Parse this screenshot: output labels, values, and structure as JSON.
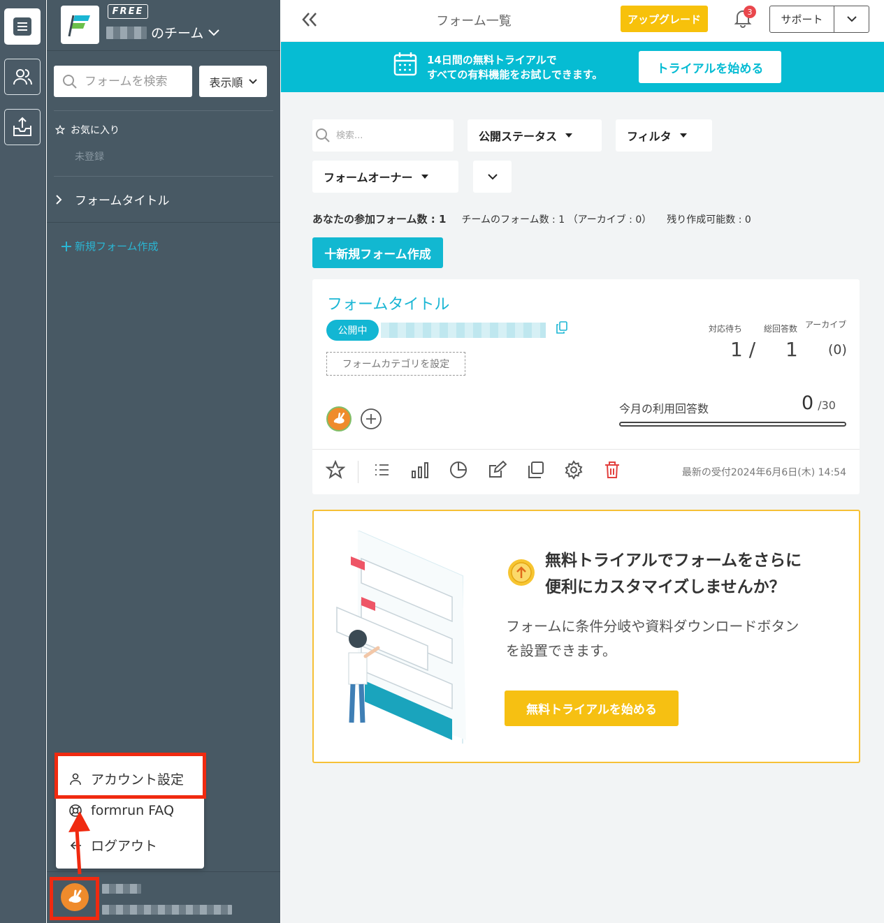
{
  "team": {
    "plan_badge": "FREE",
    "name_suffix": "のチーム"
  },
  "sidebar": {
    "search_placeholder": "フォームを検索",
    "sort_label": "表示順",
    "favorites_label": "お気に入り",
    "favorites_empty": "未登録",
    "form_item": "フォームタイトル",
    "new_form": "新規フォーム作成"
  },
  "account_menu": {
    "items": [
      {
        "label": "アカウント設定",
        "icon": "user-icon"
      },
      {
        "label": "formrun FAQ",
        "icon": "lifebuoy-icon"
      },
      {
        "label": "ログアウト",
        "icon": "logout-arrow-icon"
      }
    ]
  },
  "topbar": {
    "title": "フォーム一覧",
    "upgrade": "アップグレード",
    "notifications_count": "3",
    "support": "サポート"
  },
  "banner": {
    "line1": "14日間の無料トライアルで",
    "line2": "すべての有料機能をお試しできます。",
    "button": "トライアルを始める"
  },
  "filters": {
    "search_placeholder": "検索...",
    "status": "公開ステータス",
    "filter": "フィルタ",
    "owner": "フォームオーナー"
  },
  "counts": {
    "participating": "あなたの参加フォーム数 : 1",
    "team": "チームのフォーム数 : 1 （アーカイブ : 0）",
    "remaining": "残り作成可能数 : 0"
  },
  "new_form_button": "十新規フォーム作成",
  "form_card": {
    "title": "フォームタイトル",
    "status": "公開中",
    "category_button": "フォームカテゴリを設定",
    "stats": {
      "pending_label": "対応待ち",
      "pending_value": "1 /",
      "total_label": "総回答数",
      "total_value": "1",
      "archive_label": "アーカイブ",
      "archive_value": "(0)"
    },
    "usage_label": "今月の利用回答数",
    "usage_value": "0",
    "usage_max": "/30",
    "usage_fraction": 0,
    "last_received": "最新の受付2024年6月6日(木) 14:54"
  },
  "promo": {
    "title_line1": "無料トライアルでフォームをさらに",
    "title_line2": "便利にカスタマイズしませんか？",
    "desc_line1": "フォームに条件分岐や資料ダウンロードボタン",
    "desc_line2": "を設置できます。",
    "button": "無料トライアルを始める"
  },
  "colors": {
    "accent": "#12b8d1",
    "upgrade": "#f7c10b",
    "sidebar": "#485964",
    "highlight": "#f02a10"
  }
}
